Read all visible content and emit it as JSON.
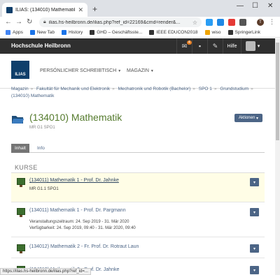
{
  "browser": {
    "tab_title": "ILIAS: (134010) Mathematik",
    "url": "ilias.hs-heilbronn.de/ilias.php?ref_id=22169&cmd=render&...",
    "bookmarks": [
      {
        "label": "Apps",
        "color": "#4285f4"
      },
      {
        "label": "New Tab",
        "color": "#1a73e8"
      },
      {
        "label": "History",
        "color": "#1a73e8"
      },
      {
        "label": "GHD – Geschäftsste...",
        "color": "#333333"
      },
      {
        "label": "IEEE EDUCON2018",
        "color": "#333333"
      },
      {
        "label": "wiso",
        "color": "#f0a400"
      },
      {
        "label": "SpringerLink",
        "color": "#333333"
      }
    ],
    "profile_initial": "T",
    "status_url": "https://ilias.hs-heilbronn.de/ilias.php?ref_id=..."
  },
  "topbar": {
    "brand": "Hochschule Heilbronn",
    "mail_badge": "4",
    "help": "Hilfe"
  },
  "nav": {
    "logo": "ILIAS",
    "items": [
      "PERSÖNLICHER SCHREIBTISCH",
      "MAGAZIN"
    ]
  },
  "breadcrumb": [
    "Magazin",
    "Fakultät für Mechanik und Elektronik",
    "Mechatronik und Robotik (Bachelor)",
    "SPO 1",
    "Grundstudium",
    "(134010) Mathematik"
  ],
  "header": {
    "title": "(134010) Mathematik",
    "subtitle": "MR G1 SPO1",
    "actions_label": "Aktionen"
  },
  "tabs": [
    "Inhalt",
    "Info"
  ],
  "section": {
    "title": "KURSE",
    "items": [
      {
        "name": "(134011) Mathematik 1 - Prof. Dr. Jahnke",
        "meta": [
          "MR G1.1 SPO1"
        ]
      },
      {
        "name": "(134011) Mathematik 1 - Prof. Dr. Pargmann",
        "meta": [
          "Veranstaltungszeitraum: 24. Sep 2019 - 31. Mär 2020",
          "Verfügbarkeit: 24. Sep 2019, 09:40 - 31. Mär 2020, 09:40"
        ]
      },
      {
        "name": "(134012) Mathematik 2 - Fr. Prof. Dr. Rotraut Laun",
        "meta": []
      },
      {
        "name": "(134012) Mathematik 2 - Prof. Dr. Jahnke",
        "meta": []
      }
    ]
  },
  "colors": {
    "title_green": "#557b2e",
    "link_blue": "#4c6586",
    "topbar": "#2f2f2f"
  }
}
